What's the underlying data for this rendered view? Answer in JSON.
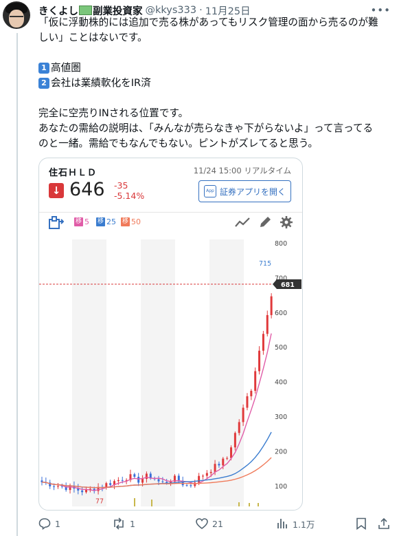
{
  "post": {
    "author_name": "きくよし",
    "author_suffix": "副業投資家",
    "handle": "@kkys333",
    "dot": "·",
    "date": "11月25日",
    "lines": [
      "「仮に浮動株的には追加で売る株があってもリスク管理の面から売るのが難",
      "しい」ことはないです。"
    ],
    "list": [
      {
        "badge": "1",
        "text": "高値圏"
      },
      {
        "badge": "2",
        "text": "会社は業績軟化をIR済"
      }
    ],
    "lines2": [
      "完全に空売りINされる位置です。",
      "あなたの需給の説明は、「みんなが売らなきゃ下がらないよ」って言ってる",
      "のと一緒。需給でもなんでもない。ピントがズレてると思う。"
    ]
  },
  "card": {
    "stock_name": "住石ＨＬＤ",
    "timestamp": "11/24 15:00 リアルタイム",
    "price": "646",
    "change": "-35",
    "change_pct": "-5.14%",
    "open_app_label": "証券アプリを開く",
    "app_icon_text": "App",
    "ma": [
      {
        "tag": "移",
        "value": "5",
        "color": "#e05ca7"
      },
      {
        "tag": "移",
        "value": "25",
        "color": "#3a7ccf"
      },
      {
        "tag": "移",
        "value": "50",
        "color": "#f07a5a"
      }
    ]
  },
  "chart_data": {
    "type": "candlestick",
    "y_ticks": [
      100,
      200,
      300,
      400,
      500,
      600,
      700,
      800
    ],
    "ylim": [
      40,
      810
    ],
    "high_label": "715",
    "low_label": "77",
    "current_label": "681",
    "current_value": 681,
    "colors": {
      "up": "#e0393b",
      "down": "#3a6fd8",
      "ma5": "#e05ca7",
      "ma25": "#3a7ccf",
      "ma50": "#f07a5a",
      "volume": "#c8b74a"
    }
  },
  "footer": {
    "replies": "1",
    "reposts": "1",
    "likes": "21",
    "views": "1.1万"
  }
}
